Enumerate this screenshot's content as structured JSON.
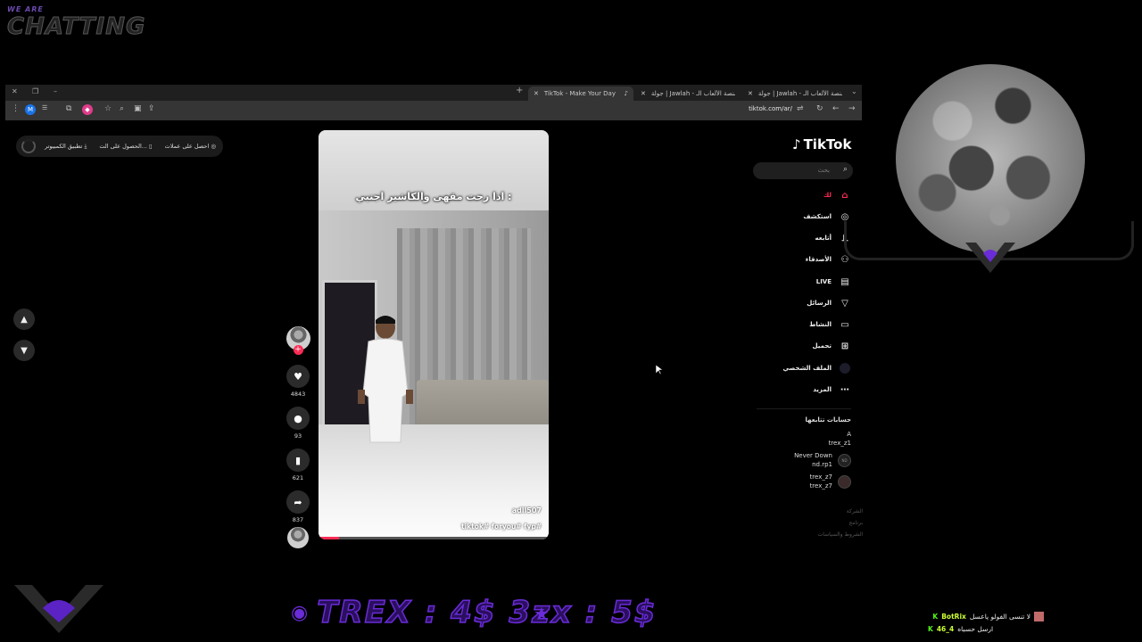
{
  "overlay": {
    "brand_small": "WE ARE",
    "brand_big": "CHATTING",
    "ticker": "TREX : 4$   3zx : 5$",
    "chat": [
      {
        "user": "BotRix",
        "message": "لا تنسى الفولو ياعسل"
      },
      {
        "user": "46_4",
        "message": "ارسل حسباه"
      }
    ]
  },
  "browser": {
    "tabs": [
      {
        "label": "TikTok - Make Your Day",
        "active": true
      },
      {
        "label": "جولة | Jawlah - منصة الألعاب الـ",
        "active": false
      },
      {
        "label": "جولة | Jawlah - منصة الألعاب الـ",
        "active": false
      }
    ],
    "url": "tiktok.com/ar/"
  },
  "tiktok": {
    "pills": [
      "احصل على عملات",
      "الحصول على الت...",
      "تطبيق الكمبيوتر"
    ],
    "logo": "TikTok",
    "search_placeholder": "بحث",
    "nav": [
      {
        "label": "لك",
        "icon": "home-icon"
      },
      {
        "label": "استكشف",
        "icon": "compass-icon"
      },
      {
        "label": "أتابعه",
        "icon": "following-icon"
      },
      {
        "label": "الأصدقاء",
        "icon": "friends-icon"
      },
      {
        "label": "LIVE",
        "icon": "live-icon"
      },
      {
        "label": "الرسائل",
        "icon": "messages-icon"
      },
      {
        "label": "النشاط",
        "icon": "activity-icon"
      },
      {
        "label": "تحميل",
        "icon": "upload-icon"
      },
      {
        "label": "الملف الشخصي",
        "icon": "profile-icon"
      },
      {
        "label": "المزيد",
        "icon": "more-icon"
      }
    ],
    "following_title": "حسابات تتابعها",
    "following": [
      {
        "name": "A",
        "handle": "trex_z1"
      },
      {
        "name": "Never Down",
        "handle": "nd.rp1"
      },
      {
        "name": "trex_z7",
        "handle": "trex_z7"
      }
    ],
    "footer": [
      "الشركة",
      "برنامج",
      "الشروط والسياسات"
    ],
    "video": {
      "caption": "اذا رحت مقهى والكاشير اجنبي :",
      "username": "adll507",
      "hashtags": "tiktok# foryou# fyp#",
      "likes": "4843",
      "comments": "93",
      "saves": "621",
      "shares": "837",
      "progress": 0.09
    }
  },
  "colors": {
    "accent": "#fe2c55",
    "overlay_purple": "#6a2bd8"
  }
}
